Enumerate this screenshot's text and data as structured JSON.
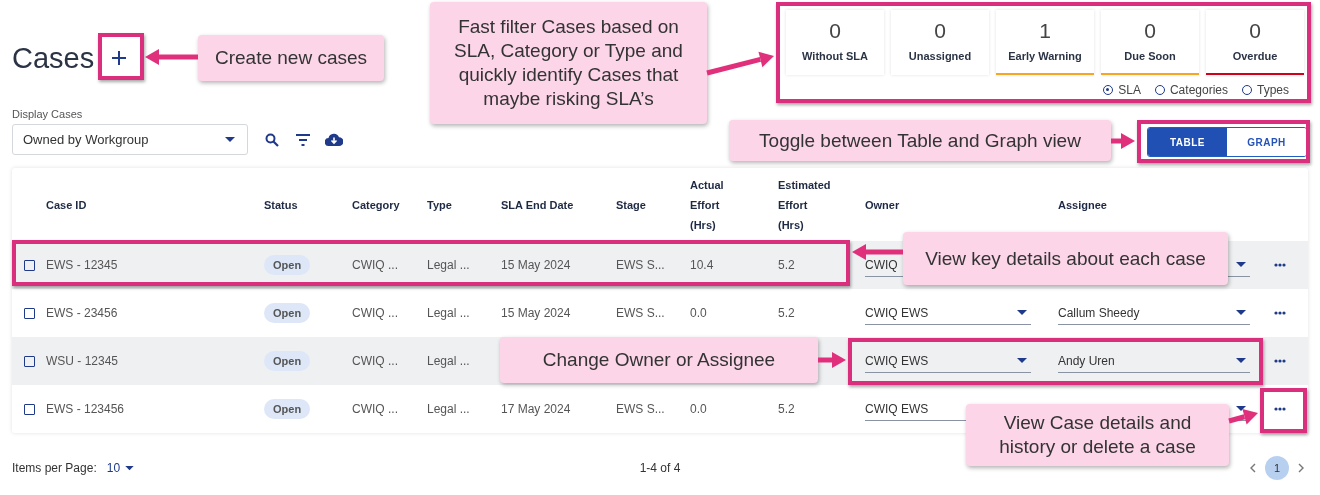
{
  "page": {
    "title": "Cases",
    "display_label": "Display Cases",
    "display_value": "Owned by Workgroup"
  },
  "sla_cards": [
    {
      "count": "0",
      "label": "Without SLA"
    },
    {
      "count": "0",
      "label": "Unassigned"
    },
    {
      "count": "1",
      "label": "Early Warning",
      "color": "#f5a623"
    },
    {
      "count": "0",
      "label": "Due Soon",
      "color": "#f5a623"
    },
    {
      "count": "0",
      "label": "Overdue",
      "color": "#d0021b"
    }
  ],
  "filter_options": [
    {
      "label": "SLA",
      "selected": true
    },
    {
      "label": "Categories",
      "selected": false
    },
    {
      "label": "Types",
      "selected": false
    }
  ],
  "view_tabs": [
    {
      "label": "TABLE",
      "selected": true
    },
    {
      "label": "GRAPH",
      "selected": false
    }
  ],
  "table": {
    "columns": [
      "Case ID",
      "Status",
      "Category",
      "Type",
      "SLA End Date",
      "Stage",
      "Actual Effort (Hrs)",
      "Estimated Effort (Hrs)",
      "Owner",
      "Assignee"
    ],
    "rows": [
      {
        "checked": false,
        "case_id": "EWS - 12345",
        "status": "Open",
        "category": "CWIQ ...",
        "type": "Legal ...",
        "sla_end_date": "15 May 2024",
        "stage": "EWS S...",
        "actual_effort": "10.4",
        "estimated_effort": "5.2",
        "owner": "CWIQ"
      },
      {
        "checked": false,
        "case_id": "EWS - 23456",
        "status": "Open",
        "category": "CWIQ ...",
        "type": "Legal ...",
        "sla_end_date": "15 May 2024",
        "stage": "EWS S...",
        "actual_effort": "0.0",
        "estimated_effort": "5.2",
        "owner": "CWIQ EWS",
        "assignee": "Callum Sheedy"
      },
      {
        "checked": false,
        "case_id": "WSU - 12345",
        "status": "Open",
        "category": "CWIQ ...",
        "type": "Legal ...",
        "owner": "CWIQ EWS",
        "assignee": "Andy Uren"
      },
      {
        "checked": false,
        "case_id": "EWS - 123456",
        "status": "Open",
        "category": "CWIQ ...",
        "type": "Legal ...",
        "sla_end_date": "17 May 2024",
        "stage": "EWS S...",
        "actual_effort": "0.0",
        "estimated_effort": "5.2",
        "owner": "CWIQ EWS"
      }
    ]
  },
  "pagination": {
    "items_per_page_label": "Items per Page:",
    "items_per_page": "10",
    "range": "1-4 of 4",
    "pages": [
      {
        "label": "1",
        "selected": true
      }
    ]
  },
  "annotations": [
    {
      "text": "Create new cases"
    },
    {
      "text": "Fast filter Cases based on SLA, Category or Type and quickly identify Cases that maybe risking SLA’s"
    },
    {
      "text": "Toggle between Table and Graph view"
    },
    {
      "text": "View key details about each case"
    },
    {
      "text": "Change Owner or Assignee"
    },
    {
      "text": "View Case details and history or delete a case"
    }
  ]
}
